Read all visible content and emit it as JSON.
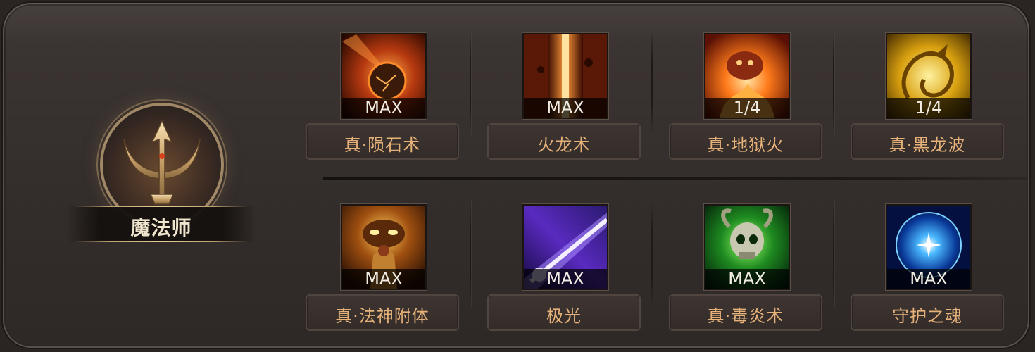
{
  "class": {
    "name": "魔法师"
  },
  "skills": [
    {
      "name": "真·陨石术",
      "level": "MAX",
      "icon": "meteor-icon"
    },
    {
      "name": "火龙术",
      "level": "MAX",
      "icon": "fire-dragon-icon"
    },
    {
      "name": "真·地狱火",
      "level": "1/4",
      "icon": "hellfire-icon"
    },
    {
      "name": "真·黑龙波",
      "level": "1/4",
      "icon": "black-dragon-wave-icon"
    },
    {
      "name": "真·法神附体",
      "level": "MAX",
      "icon": "mage-god-possession-icon"
    },
    {
      "name": "极光",
      "level": "MAX",
      "icon": "aurora-icon"
    },
    {
      "name": "真·毒炎术",
      "level": "MAX",
      "icon": "poison-flame-icon"
    },
    {
      "name": "守护之魂",
      "level": "MAX",
      "icon": "guardian-soul-icon"
    }
  ],
  "colors": {
    "panel": "#3a3331",
    "skill_name": "#e7b27a",
    "name_box_border": "#51463f",
    "class_name": "#efe4cc"
  }
}
